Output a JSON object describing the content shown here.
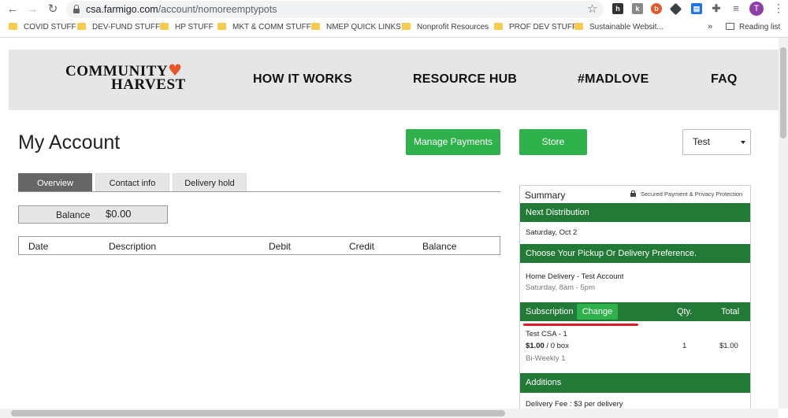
{
  "browser": {
    "url_host": "csa.farmigo.com",
    "url_path": "/account/nomoreemptypots",
    "profile_initial": "T",
    "bookmarks": [
      "COVID STUFF",
      "DEV-FUND STUFF",
      "HP STUFF",
      "MKT & COMM STUFF",
      "NMEP QUICK LINKS",
      "Nonprofit Resources",
      "PROF DEV STUFF",
      "Sustainable Websit..."
    ],
    "more": "»",
    "reading_list": "Reading list"
  },
  "site": {
    "logo_line1": "COMMUNITY",
    "logo_line2": "HARVEST",
    "logo_heart": "♥",
    "nav": [
      "HOW IT WORKS",
      "RESOURCE HUB",
      "#MADLOVE",
      "FAQ"
    ]
  },
  "account": {
    "title": "My Account",
    "manage_payments": "Manage Payments",
    "store": "Store",
    "select_value": "Test",
    "tabs": [
      "Overview",
      "Contact info",
      "Delivery hold"
    ],
    "active_tab": "Overview",
    "balance_label": "Balance",
    "balance_amount": "$0.00",
    "ledger_columns": [
      "Date",
      "Description",
      "Debit",
      "Credit",
      "Balance"
    ]
  },
  "summary": {
    "title": "Summary",
    "secure_note": "Secured Payment & Privacy Protection",
    "next_distribution_label": "Next Distribution",
    "next_distribution_date": "Saturday, Oct 2",
    "pickup_pref_label": "Choose Your Pickup Or Delivery Preference.",
    "delivery_name": "Home Delivery - Test Account",
    "delivery_time": "Saturday, 8am - 5pm",
    "subscription_label": "Subscription",
    "change_label": "Change",
    "qty_label": "Qty.",
    "total_label": "Total",
    "item_name": "Test CSA - 1",
    "item_price": "$1.00",
    "item_unit": " / 0 box",
    "item_frequency": "Bi-Weekly 1",
    "item_qty": "1",
    "item_total": "$1.00",
    "additions_label": "Additions",
    "delivery_fee": "Delivery Fee : $3 per delivery"
  },
  "colors": {
    "green_button": "#2fb24b",
    "green_bar": "#237a37",
    "highlight": "#e01b24",
    "heart": "#e8562a"
  }
}
